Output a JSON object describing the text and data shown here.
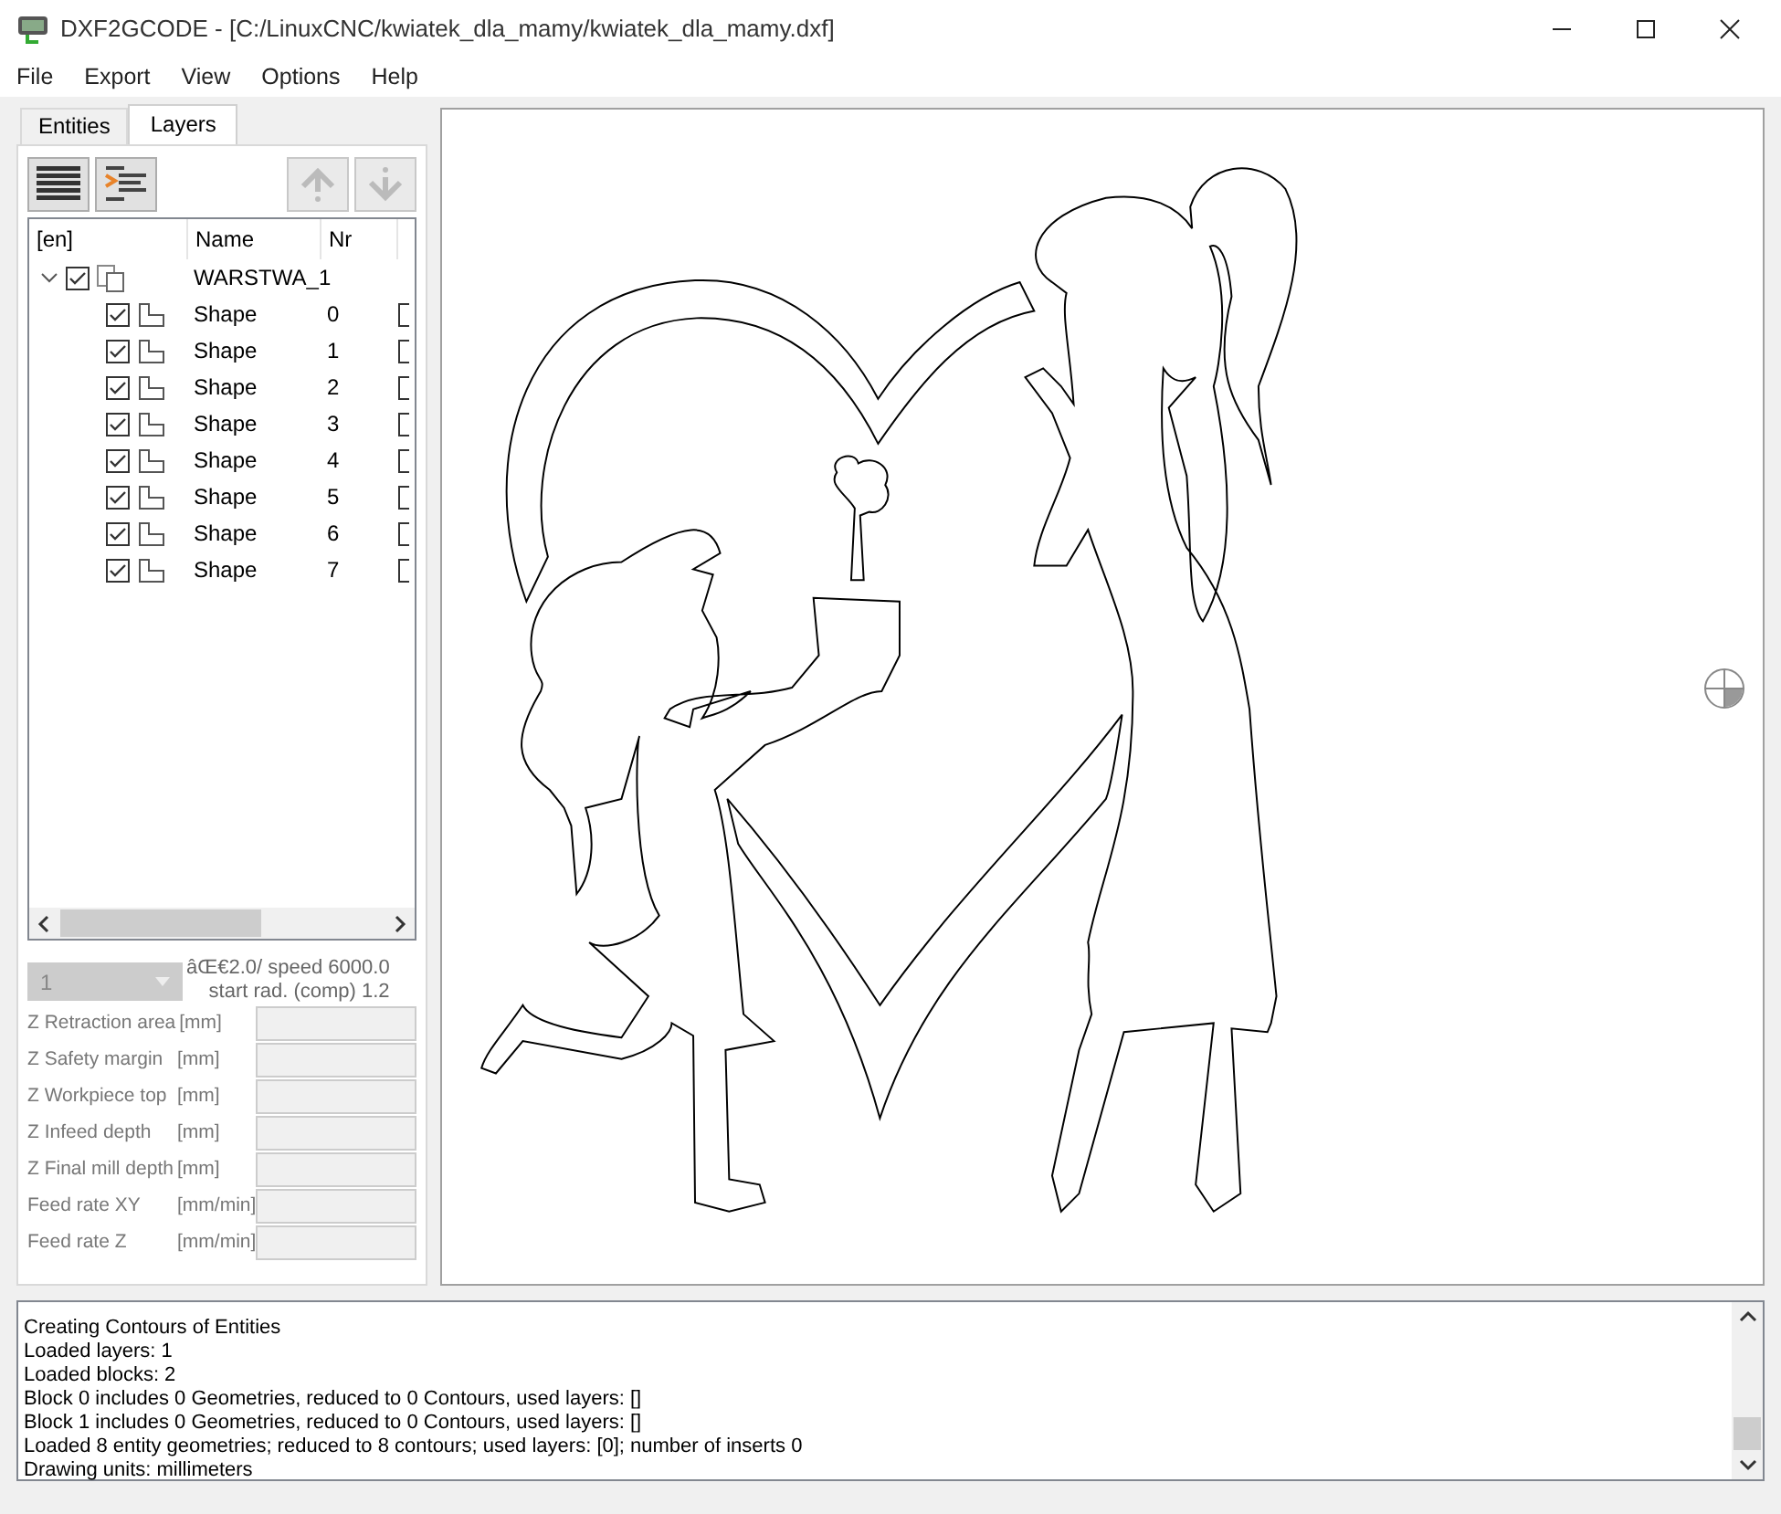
{
  "window": {
    "title": "DXF2GCODE - [C:/LinuxCNC/kwiatek_dla_mamy/kwiatek_dla_mamy.dxf]"
  },
  "menu": [
    {
      "label": "File"
    },
    {
      "label": "Export"
    },
    {
      "label": "View"
    },
    {
      "label": "Options"
    },
    {
      "label": "Help"
    }
  ],
  "tabs": [
    {
      "label": "Entities",
      "selected": false
    },
    {
      "label": "Layers",
      "selected": true
    }
  ],
  "toolbar": [
    {
      "kind": "lines",
      "disabled": false
    },
    {
      "kind": "indent",
      "disabled": false
    },
    {
      "kind": "up",
      "disabled": true
    },
    {
      "kind": "down",
      "disabled": true
    }
  ],
  "tree": {
    "columns": [
      "[en]",
      "Name",
      "Nr"
    ],
    "layers": [
      {
        "name": "WARSTWA_1",
        "checked": true,
        "expanded": true,
        "children": [
          {
            "name": "Shape",
            "nr": "0",
            "checked": true,
            "column_4_checked": false
          },
          {
            "name": "Shape",
            "nr": "1",
            "checked": true,
            "column_4_checked": false
          },
          {
            "name": "Shape",
            "nr": "2",
            "checked": true,
            "column_4_checked": false
          },
          {
            "name": "Shape",
            "nr": "3",
            "checked": true,
            "column_4_checked": false
          },
          {
            "name": "Shape",
            "nr": "4",
            "checked": true,
            "column_4_checked": false
          },
          {
            "name": "Shape",
            "nr": "5",
            "checked": true,
            "column_4_checked": false
          },
          {
            "name": "Shape",
            "nr": "6",
            "checked": true,
            "column_4_checked": false
          },
          {
            "name": "Shape",
            "nr": "7",
            "checked": true,
            "column_4_checked": false
          }
        ]
      }
    ]
  },
  "tool": {
    "value": "1",
    "disabled": true,
    "info_line_1": "âŒ€2.0/ speed 6000.0",
    "info_line_2": "start rad. (comp)  1.2"
  },
  "params": [
    {
      "label": "Z Retraction area",
      "unit": "[mm]",
      "disabled": true
    },
    {
      "label": "Z Safety margin",
      "unit": "[mm]",
      "disabled": true
    },
    {
      "label": "Z Workpiece top",
      "unit": "[mm]",
      "disabled": true
    },
    {
      "label": "Z Infeed depth",
      "unit": "[mm]",
      "disabled": true
    },
    {
      "label": "Z Final mill depth",
      "unit": "[mm]",
      "disabled": true
    },
    {
      "label": "Feed rate XY",
      "unit": "[mm/min]",
      "disabled": true
    },
    {
      "label": "Feed rate Z",
      "unit": "[mm/min]",
      "disabled": true
    }
  ],
  "log": [
    "Creating Contours of Entities",
    "Loaded layers: 1",
    "Loaded blocks: 2",
    "Block 0 includes 0 Geometries, reduced to 0 Contours, used layers: []",
    "Block 1 includes 0 Geometries, reduced to 0 Contours, used layers: []",
    "Loaded 8 entity geometries; reduced to 8 contours; used layers: [0]; number of inserts 0",
    "Drawing units: millimeters"
  ]
}
